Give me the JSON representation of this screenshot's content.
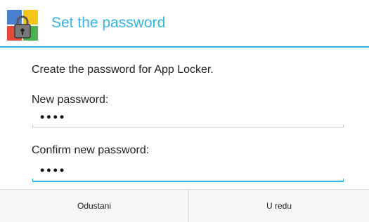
{
  "dialog": {
    "title": "Set the password",
    "app_icon": "app-locker-icon",
    "message": "Create the password for App Locker.",
    "new_password_label": "New password:",
    "new_password_value": "••••",
    "confirm_password_label": "Confirm new password:",
    "confirm_password_value": "••••",
    "cancel_label": "Odustani",
    "ok_label": "U redu"
  },
  "colors": {
    "accent": "#33b5e5",
    "text": "#222222",
    "divider": "#dcdcdc"
  }
}
